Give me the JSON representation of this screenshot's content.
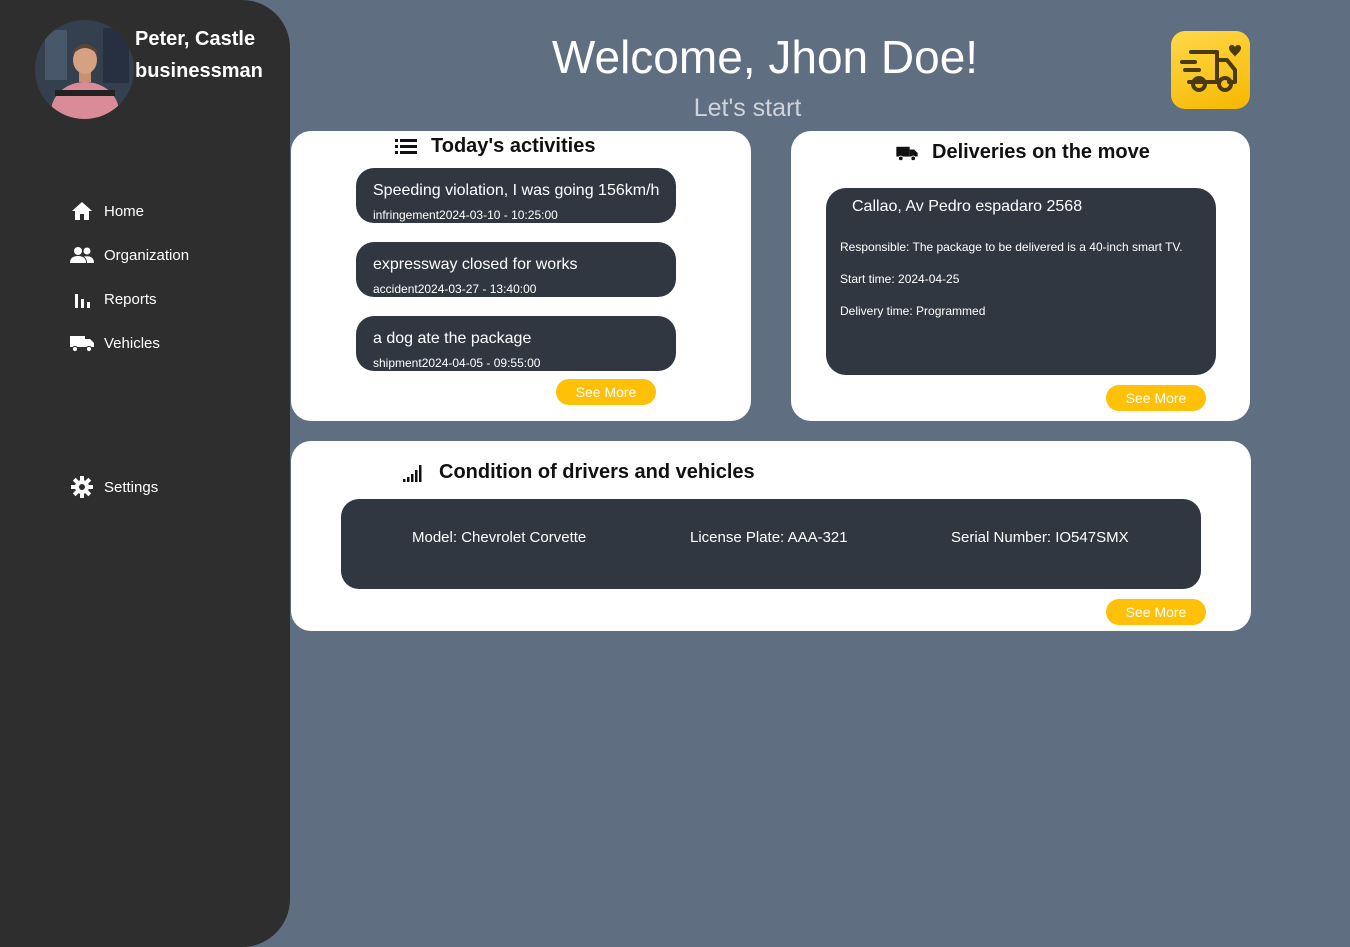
{
  "user": {
    "name": "Peter, Castle",
    "role": "businessman"
  },
  "nav": {
    "items": [
      {
        "label": "Home",
        "icon": "home-icon"
      },
      {
        "label": "Organization",
        "icon": "people-icon"
      },
      {
        "label": "Reports",
        "icon": "bar-chart-icon"
      },
      {
        "label": "Vehicles",
        "icon": "truck-icon"
      }
    ],
    "settings": {
      "label": "Settings",
      "icon": "gear-icon"
    }
  },
  "header": {
    "welcome": "Welcome, Jhon Doe!",
    "subtitle": "Let's start",
    "logo_icon": "delivery-truck-heart-icon"
  },
  "activities": {
    "title": "Today's activities",
    "icon": "list-icon",
    "items": [
      {
        "title": "Speeding violation, I was going 156km/h",
        "meta": "infringement2024-03-10 - 10:25:00"
      },
      {
        "title": "expressway closed for works",
        "meta": "accident2024-03-27 - 13:40:00"
      },
      {
        "title": "a dog ate the package",
        "meta": "shipment2024-04-05 - 09:55:00"
      }
    ],
    "see_more": "See More"
  },
  "deliveries": {
    "title": "Deliveries on the move",
    "icon": "truck-icon",
    "address": "Callao, Av Pedro espadaro 2568",
    "responsible": "Responsible: The package to be delivered is a 40-inch smart TV.",
    "start_time": "Start time: 2024-04-25",
    "delivery_time": "Delivery time: Programmed",
    "see_more": "See More"
  },
  "condition": {
    "title": "Condition of drivers and vehicles",
    "icon": "signal-bars-icon",
    "model": "Model: Chevrolet Corvette",
    "plate": "License Plate: AAA-321",
    "serial": "Serial Number: IO547SMX",
    "see_more": "See More"
  },
  "colors": {
    "background": "#5f6e80",
    "sidebar": "#2e2e2e",
    "dark_box": "#313741",
    "accent": "#ffc107"
  }
}
